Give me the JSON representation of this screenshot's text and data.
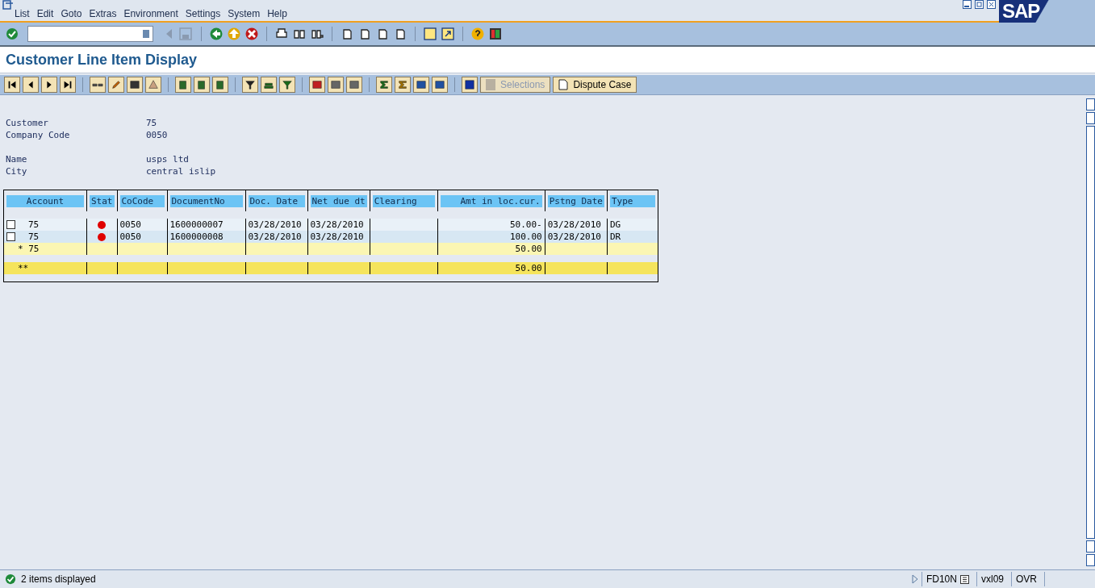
{
  "menu": [
    "List",
    "Edit",
    "Goto",
    "Extras",
    "Environment",
    "Settings",
    "System",
    "Help"
  ],
  "logo": "SAP",
  "title": "Customer Line Item Display",
  "app_buttons": [
    {
      "label": "Selections",
      "disabled": true
    },
    {
      "label": "Dispute Case",
      "disabled": false
    }
  ],
  "header_fields": [
    {
      "label": "Customer",
      "value": "75"
    },
    {
      "label": "Company Code",
      "value": "0050"
    },
    {
      "label": "Name",
      "value": "usps ltd"
    },
    {
      "label": "City",
      "value": "central islip"
    }
  ],
  "table": {
    "columns": [
      "Account",
      "Stat",
      "CoCode",
      "DocumentNo",
      "Doc. Date",
      "Net due dt",
      "Clearing",
      "Amt in loc.cur.",
      "Pstng Date",
      "Type"
    ],
    "rows": [
      {
        "kind": "item",
        "checked": false,
        "account": "75",
        "color": "#e00000",
        "cocode": "0050",
        "document_no": "1600000007",
        "doc_date": "03/28/2010",
        "net_due": "03/28/2010",
        "amount": "50.00-",
        "posting_date": "03/28/2010",
        "type": "DG"
      },
      {
        "kind": "item",
        "checked": false,
        "account": "75",
        "color": "#e00000",
        "cocode": "0050",
        "document_no": "1600000008",
        "doc_date": "03/28/2010",
        "net_due": "03/28/2010",
        "amount": "100.00",
        "posting_date": "03/28/2010",
        "type": "DR"
      },
      {
        "kind": "subtotal",
        "marker": "* 75",
        "amount": "50.00"
      },
      {
        "kind": "total",
        "marker": "**",
        "amount": "50.00"
      }
    ]
  },
  "status_bar": {
    "message": "2 items displayed",
    "transaction": "FD10N",
    "server": "vxl09",
    "mode": "OVR"
  }
}
